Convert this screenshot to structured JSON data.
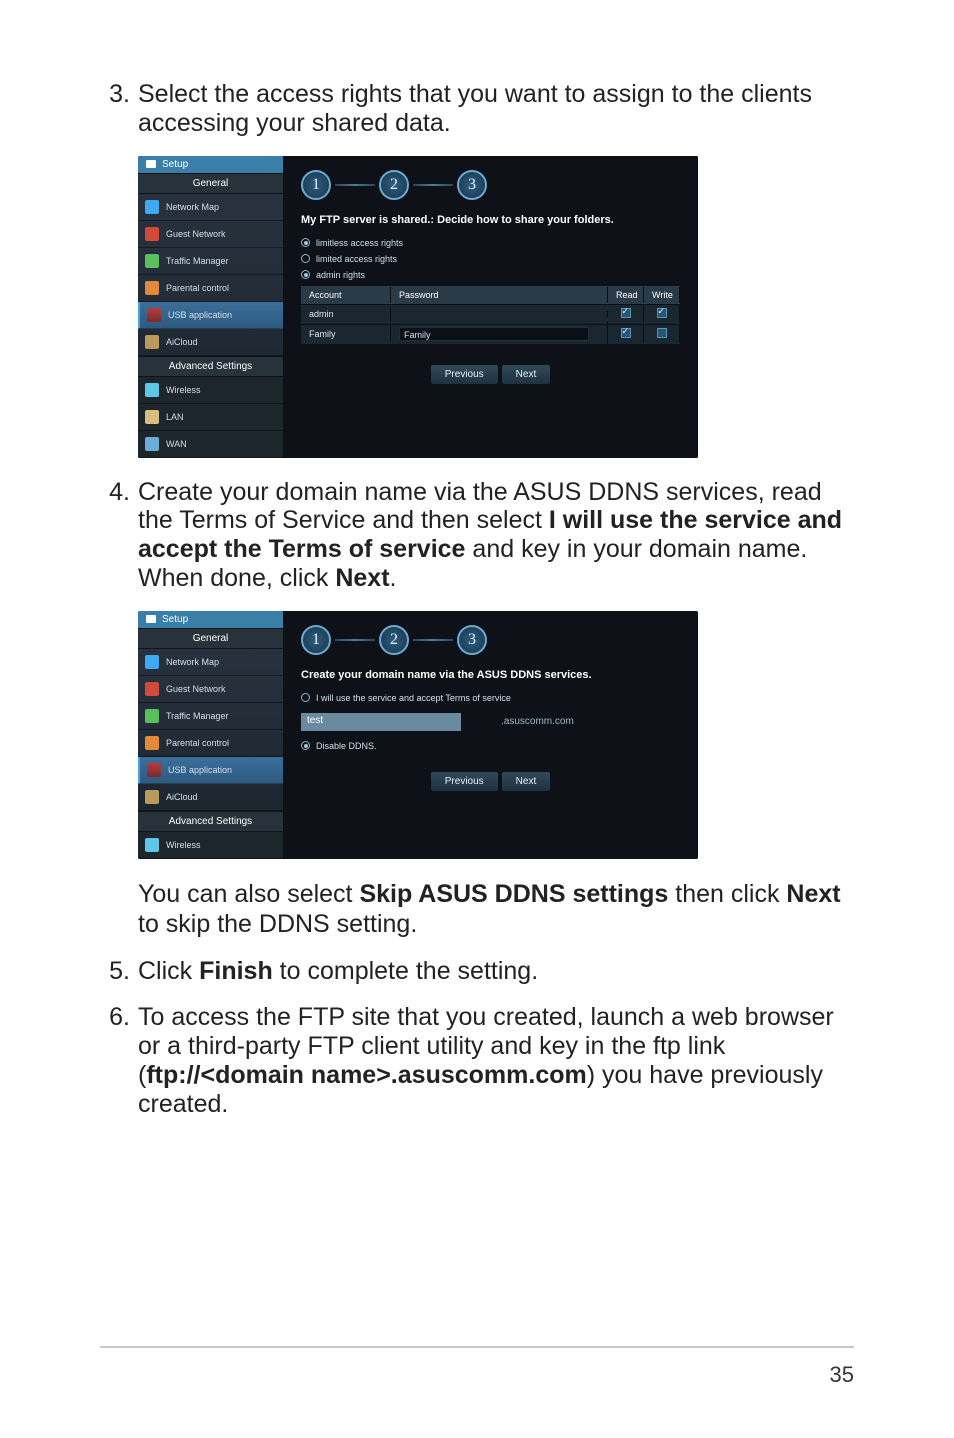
{
  "steps": {
    "s3": {
      "num": "3.",
      "text": "Select the access rights that you want to assign to the clients accessing your shared data."
    },
    "s4": {
      "num": "4.",
      "text_a": "Create your domain name via the ASUS DDNS services, read the Terms of Service and then select ",
      "bold_a": "I will use the service and accept the Terms of service",
      "text_b": " and key in your domain name. When done, click ",
      "bold_b": "Next",
      "text_c": "."
    },
    "note4": {
      "a": "You can also select ",
      "bold_a": "Skip ASUS DDNS settings",
      "b": " then click ",
      "bold_b": "Next",
      "c": " to skip the DDNS setting."
    },
    "s5": {
      "num": "5.",
      "a": "Click ",
      "bold": "Finish",
      "b": " to complete the setting."
    },
    "s6": {
      "num": "6.",
      "a": "To access the FTP site that you created, launch a web browser or a third-party FTP client utility and key in the ftp link (",
      "bold": "ftp://<domain name>.asuscomm.com",
      "b": ") you have previously created."
    }
  },
  "nav": {
    "setup": "Setup",
    "general": "General",
    "network_map": "Network Map",
    "guest_network": "Guest Network",
    "traffic_manager": "Traffic Manager",
    "parental_control": "Parental control",
    "usb_application": "USB application",
    "aicloud": "AiCloud",
    "advanced": "Advanced Settings",
    "wireless": "Wireless",
    "lan": "LAN",
    "wan": "WAN"
  },
  "shot1": {
    "title": "My FTP server is shared.: Decide how to share your folders.",
    "radio1": "limitless access rights",
    "radio2": "limited access rights",
    "radio3": "admin rights",
    "col_account": "Account",
    "col_password": "Password",
    "col_read": "Read",
    "col_write": "Write",
    "row1_acc": "admin",
    "row2_acc": "Family",
    "row2_pwd": "Family",
    "btn_prev": "Previous",
    "btn_next": "Next",
    "step1": "1",
    "step2": "2",
    "step3": "3"
  },
  "shot2": {
    "title": "Create your domain name via the ASUS DDNS services.",
    "radio1": "I will use the service and accept Terms of service",
    "input_value": "test",
    "suffix": ".asuscomm.com",
    "radio2": "Disable DDNS.",
    "btn_prev": "Previous",
    "btn_next": "Next",
    "step1": "1",
    "step2": "2",
    "step3": "3"
  },
  "page_number": "35"
}
